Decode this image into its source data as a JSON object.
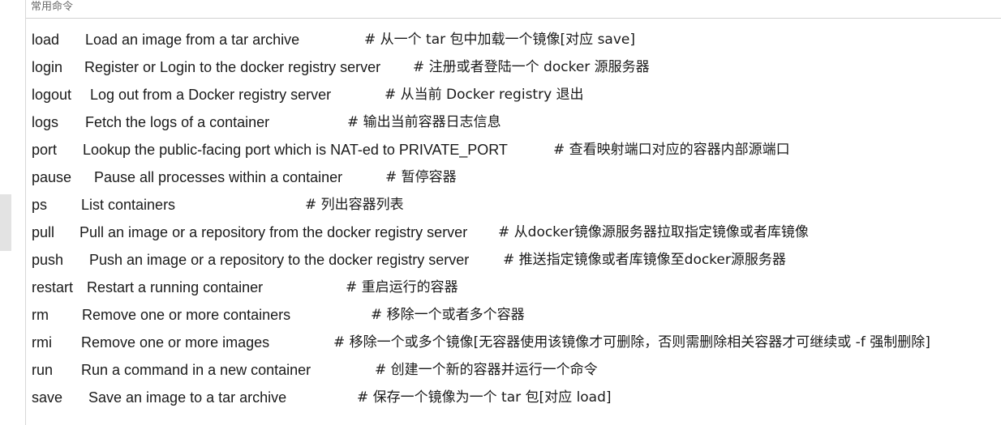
{
  "section": {
    "title": "常用命令"
  },
  "commands": [
    {
      "name": "load",
      "description": "Load an image from a tar archive",
      "comment": "# 从一个 tar 包中加载一个镜像[对应 save]"
    },
    {
      "name": "login",
      "description": "Register or Login to the docker registry server",
      "comment": "# 注册或者登陆一个 docker 源服务器"
    },
    {
      "name": "logout",
      "description": "Log out from a Docker registry server",
      "comment": "# 从当前 Docker registry 退出"
    },
    {
      "name": "logs",
      "description": "Fetch the logs of a container",
      "comment": "# 输出当前容器日志信息"
    },
    {
      "name": "port",
      "description": "Lookup the public-facing port which is NAT-ed to PRIVATE_PORT",
      "comment": "# 查看映射端口对应的容器内部源端口"
    },
    {
      "name": "pause",
      "description": "Pause all processes within a container",
      "comment": "# 暂停容器"
    },
    {
      "name": "ps",
      "description": "List containers",
      "comment": "# 列出容器列表"
    },
    {
      "name": "pull",
      "description": "Pull an image or a repository from the docker registry server",
      "comment": "# 从docker镜像源服务器拉取指定镜像或者库镜像"
    },
    {
      "name": "push",
      "description": "Push an image or a repository to the docker registry server",
      "comment": "# 推送指定镜像或者库镜像至docker源服务器"
    },
    {
      "name": "restart",
      "description": "Restart a running container",
      "comment": "# 重启运行的容器"
    },
    {
      "name": "rm",
      "description": "Remove one or more containers",
      "comment": "# 移除一个或者多个容器"
    },
    {
      "name": "rmi",
      "description": "Remove one or more images",
      "comment": "# 移除一个或多个镜像[无容器使用该镜像才可删除，否则需删除相关容器才可继续或 -f 强制删除]"
    },
    {
      "name": "run",
      "description": "Run a command in a new container",
      "comment": "# 创建一个新的容器并运行一个命令"
    },
    {
      "name": "save",
      "description": "Save an image to a tar archive",
      "comment": "# 保存一个镜像为一个 tar 包[对应 load]"
    }
  ]
}
